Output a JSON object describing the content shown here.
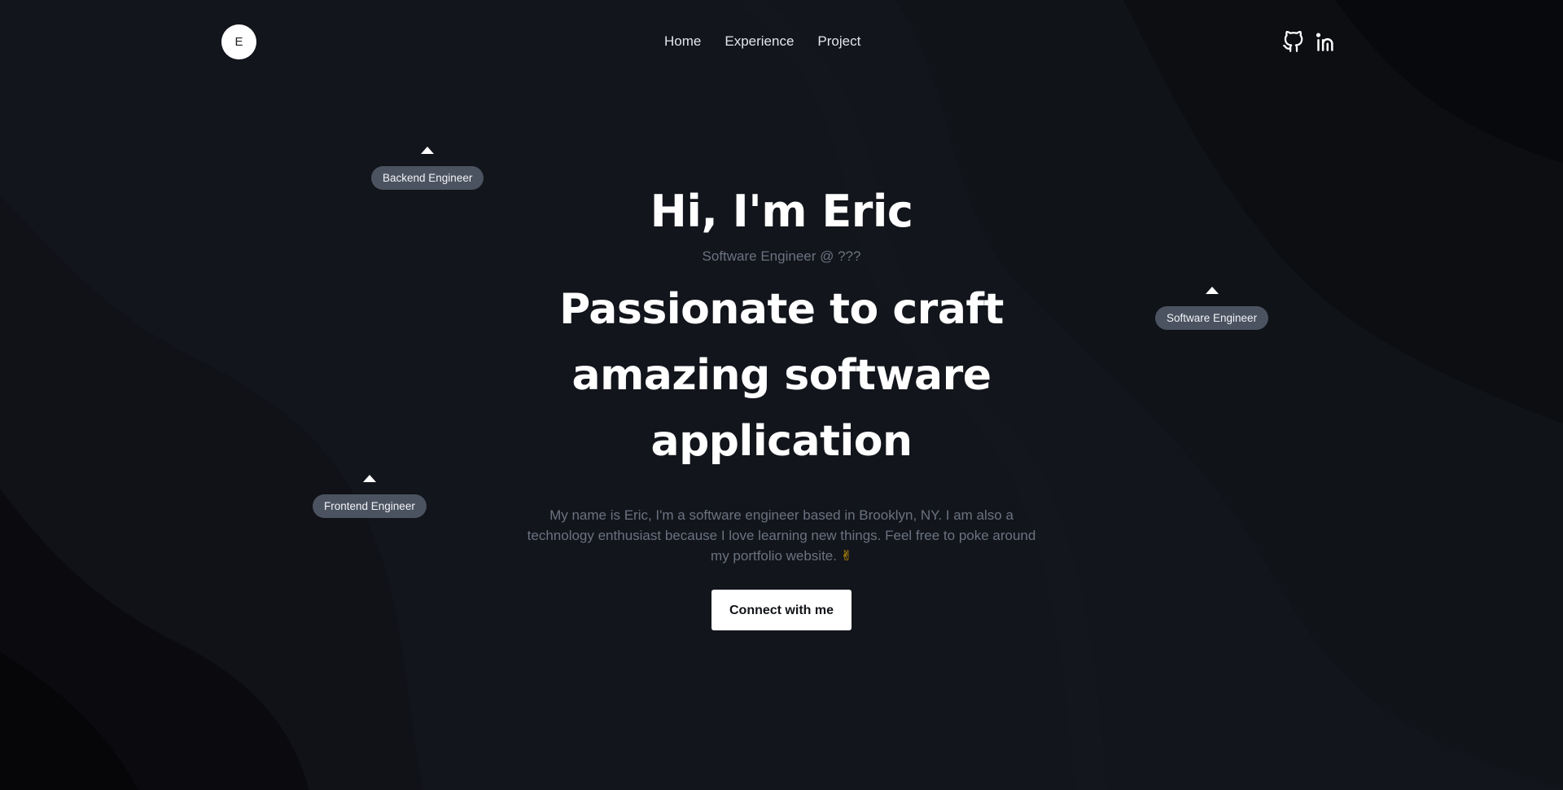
{
  "logo": {
    "letter": "E"
  },
  "nav": {
    "items": [
      {
        "label": "Home"
      },
      {
        "label": "Experience"
      },
      {
        "label": "Project"
      }
    ]
  },
  "social": {
    "icons": [
      "github-icon",
      "linkedin-icon"
    ]
  },
  "tags": {
    "backend": "Backend Engineer",
    "frontend": "Frontend Engineer",
    "software": "Software Engineer"
  },
  "hero": {
    "title": "Hi, I'm Eric",
    "subtitle": "Software Engineer @ ???",
    "headline_lines": [
      "Passionate to craft",
      "amazing software",
      "application"
    ],
    "description": "My name is Eric, I'm a software engineer based in Brooklyn, NY. I am also a technology enthusiast because I love learning new things. Feel free to poke around my portfolio website.",
    "description_emoji": "✌",
    "cta_label": "Connect with me"
  },
  "colors": {
    "background": "#11141a",
    "tag_pill": "#4b5361",
    "muted_text": "#6b7280",
    "cta_bg": "#ffffff"
  }
}
